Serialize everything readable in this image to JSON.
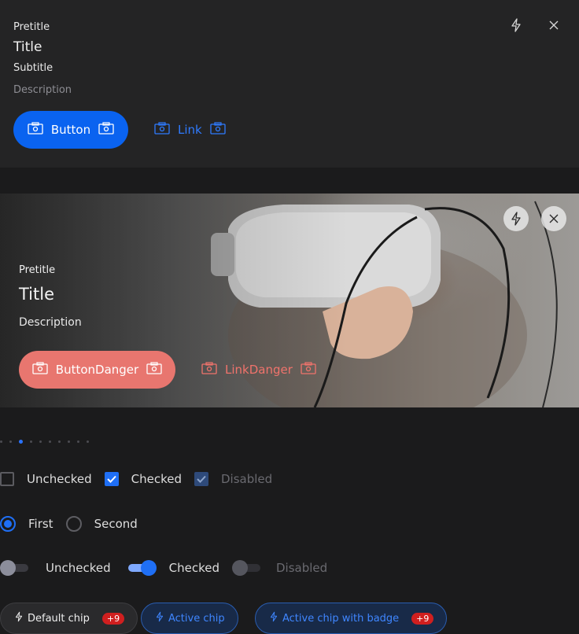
{
  "card1": {
    "pretitle": "Pretitle",
    "title": "Title",
    "subtitle": "Subtitle",
    "description": "Description",
    "button_label": "Button",
    "link_label": "Link",
    "top_icons": [
      "lightning-icon",
      "close-icon"
    ]
  },
  "card2": {
    "pretitle": "Pretitle",
    "title": "Title",
    "description": "Description",
    "button_label": "ButtonDanger",
    "link_label": "LinkDanger",
    "top_icons": [
      "lightning-icon",
      "close-icon"
    ],
    "image_subject": "person wearing VR headset"
  },
  "pagination": {
    "count": 10,
    "active_index": 2
  },
  "checkboxes": [
    {
      "label": "Unchecked",
      "state": "unchecked"
    },
    {
      "label": "Checked",
      "state": "checked"
    },
    {
      "label": "Disabled",
      "state": "disabled"
    }
  ],
  "radios": [
    {
      "label": "First",
      "checked": true
    },
    {
      "label": "Second",
      "checked": false
    }
  ],
  "toggles": [
    {
      "label": "Unchecked",
      "state": "off"
    },
    {
      "label": "Checked",
      "state": "on"
    },
    {
      "label": "Disabled",
      "state": "disabled"
    }
  ],
  "chips": [
    {
      "label": "Default chip",
      "badge": "+9",
      "variant": "default"
    },
    {
      "label": "Active chip",
      "badge": "",
      "variant": "active"
    },
    {
      "label": "Active chip with badge",
      "badge": "+9",
      "variant": "active"
    }
  ],
  "colors": {
    "primary": "#0a63f0",
    "danger": "#e8766f",
    "link": "#2f7bff",
    "badge": "#d01f1f"
  }
}
